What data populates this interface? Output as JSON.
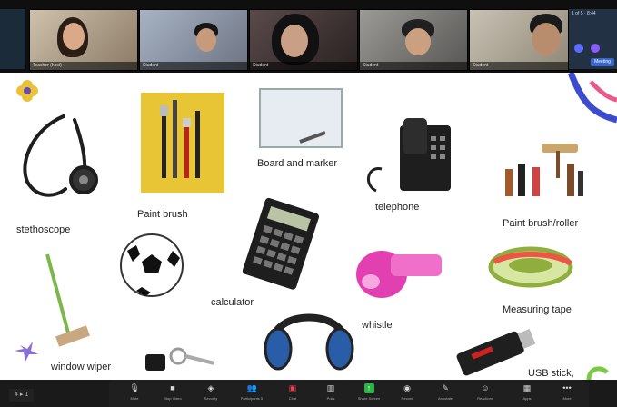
{
  "gallery": {
    "participants": [
      {
        "name": "Teacher (host)"
      },
      {
        "name": "Student"
      },
      {
        "name": "Student"
      },
      {
        "name": "Student"
      },
      {
        "name": "Student"
      }
    ],
    "right_panel": {
      "title": "1 of 5 · 8:44",
      "button": "Meeting"
    }
  },
  "slide": {
    "labels": {
      "stethoscope": "stethoscope",
      "paint_brush": "Paint brush",
      "board_marker": "Board and marker",
      "telephone": "telephone",
      "paint_brush_roller": "Paint brush/roller",
      "calculator": "calculator",
      "whistle": "whistle",
      "measuring_tape": "Measuring tape",
      "window_wiper": "window wiper",
      "usb_stick": "USB stick,"
    }
  },
  "pager": {
    "text": "4 ▸ 1"
  },
  "toolbar": {
    "mute": "Mute",
    "stop_video": "Stop Video",
    "security": "Security",
    "participants": "Participants",
    "participants_count": "5",
    "chat": "Chat",
    "polls": "Polls",
    "share_screen": "Share Screen",
    "record": "Record",
    "annotate": "Annotate",
    "reactions": "Reactions",
    "apps": "Apps",
    "more": "More"
  }
}
